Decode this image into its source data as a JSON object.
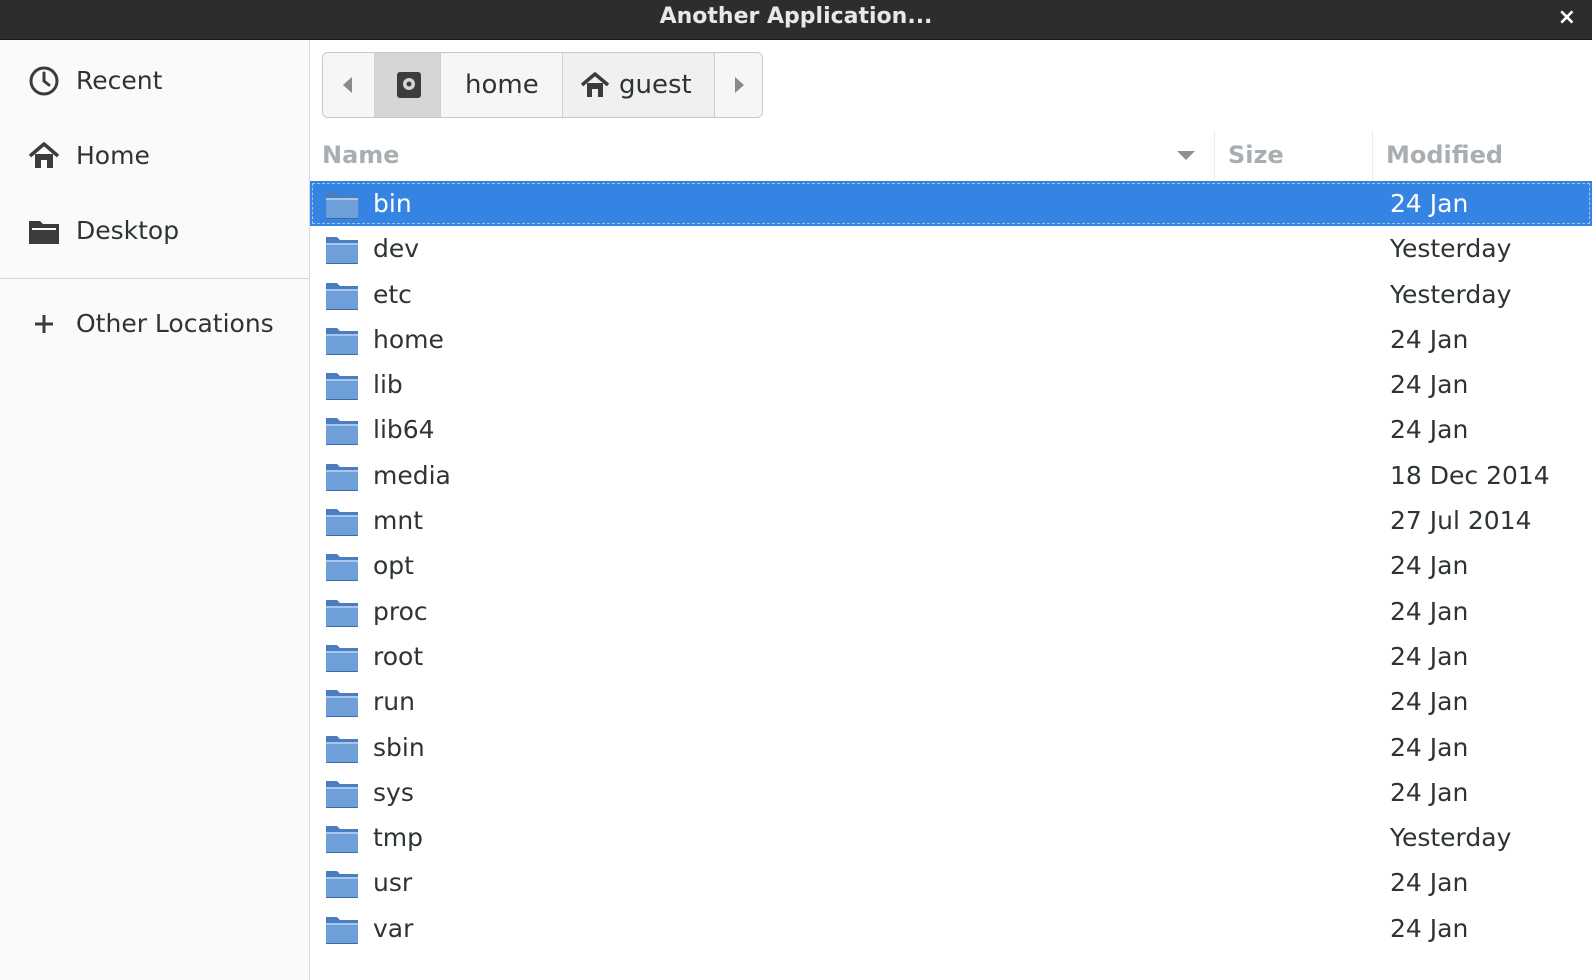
{
  "window": {
    "title": "Another Application...",
    "close_glyph": "×"
  },
  "sidebar": {
    "items": [
      {
        "label": "Recent",
        "icon": "clock-icon"
      },
      {
        "label": "Home",
        "icon": "home-icon"
      },
      {
        "label": "Desktop",
        "icon": "folder-icon"
      },
      {
        "label": "Other Locations",
        "icon": "plus-icon"
      }
    ]
  },
  "pathbar": {
    "segments": [
      "home",
      "guest"
    ],
    "root_icon": "drive-icon",
    "guest_icon": "home-icon"
  },
  "filelist": {
    "columns": {
      "name": "Name",
      "size": "Size",
      "modified": "Modified"
    },
    "sort_column": "Name",
    "selected_row": "bin",
    "rows": [
      {
        "name": "bin",
        "size": "",
        "modified": "24 Jan"
      },
      {
        "name": "dev",
        "size": "",
        "modified": "Yesterday"
      },
      {
        "name": "etc",
        "size": "",
        "modified": "Yesterday"
      },
      {
        "name": "home",
        "size": "",
        "modified": "24 Jan"
      },
      {
        "name": "lib",
        "size": "",
        "modified": "24 Jan"
      },
      {
        "name": "lib64",
        "size": "",
        "modified": "24 Jan"
      },
      {
        "name": "media",
        "size": "",
        "modified": "18 Dec 2014"
      },
      {
        "name": "mnt",
        "size": "",
        "modified": "27 Jul 2014"
      },
      {
        "name": "opt",
        "size": "",
        "modified": "24 Jan"
      },
      {
        "name": "proc",
        "size": "",
        "modified": "24 Jan"
      },
      {
        "name": "root",
        "size": "",
        "modified": "24 Jan"
      },
      {
        "name": "run",
        "size": "",
        "modified": "24 Jan"
      },
      {
        "name": "sbin",
        "size": "",
        "modified": "24 Jan"
      },
      {
        "name": "sys",
        "size": "",
        "modified": "24 Jan"
      },
      {
        "name": "tmp",
        "size": "",
        "modified": "Yesterday"
      },
      {
        "name": "usr",
        "size": "",
        "modified": "24 Jan"
      },
      {
        "name": "var",
        "size": "",
        "modified": "24 Jan"
      }
    ]
  },
  "colors": {
    "selection": "#3584e4",
    "titlebar": "#2d2d2d",
    "folder": "#5b8fd0"
  }
}
